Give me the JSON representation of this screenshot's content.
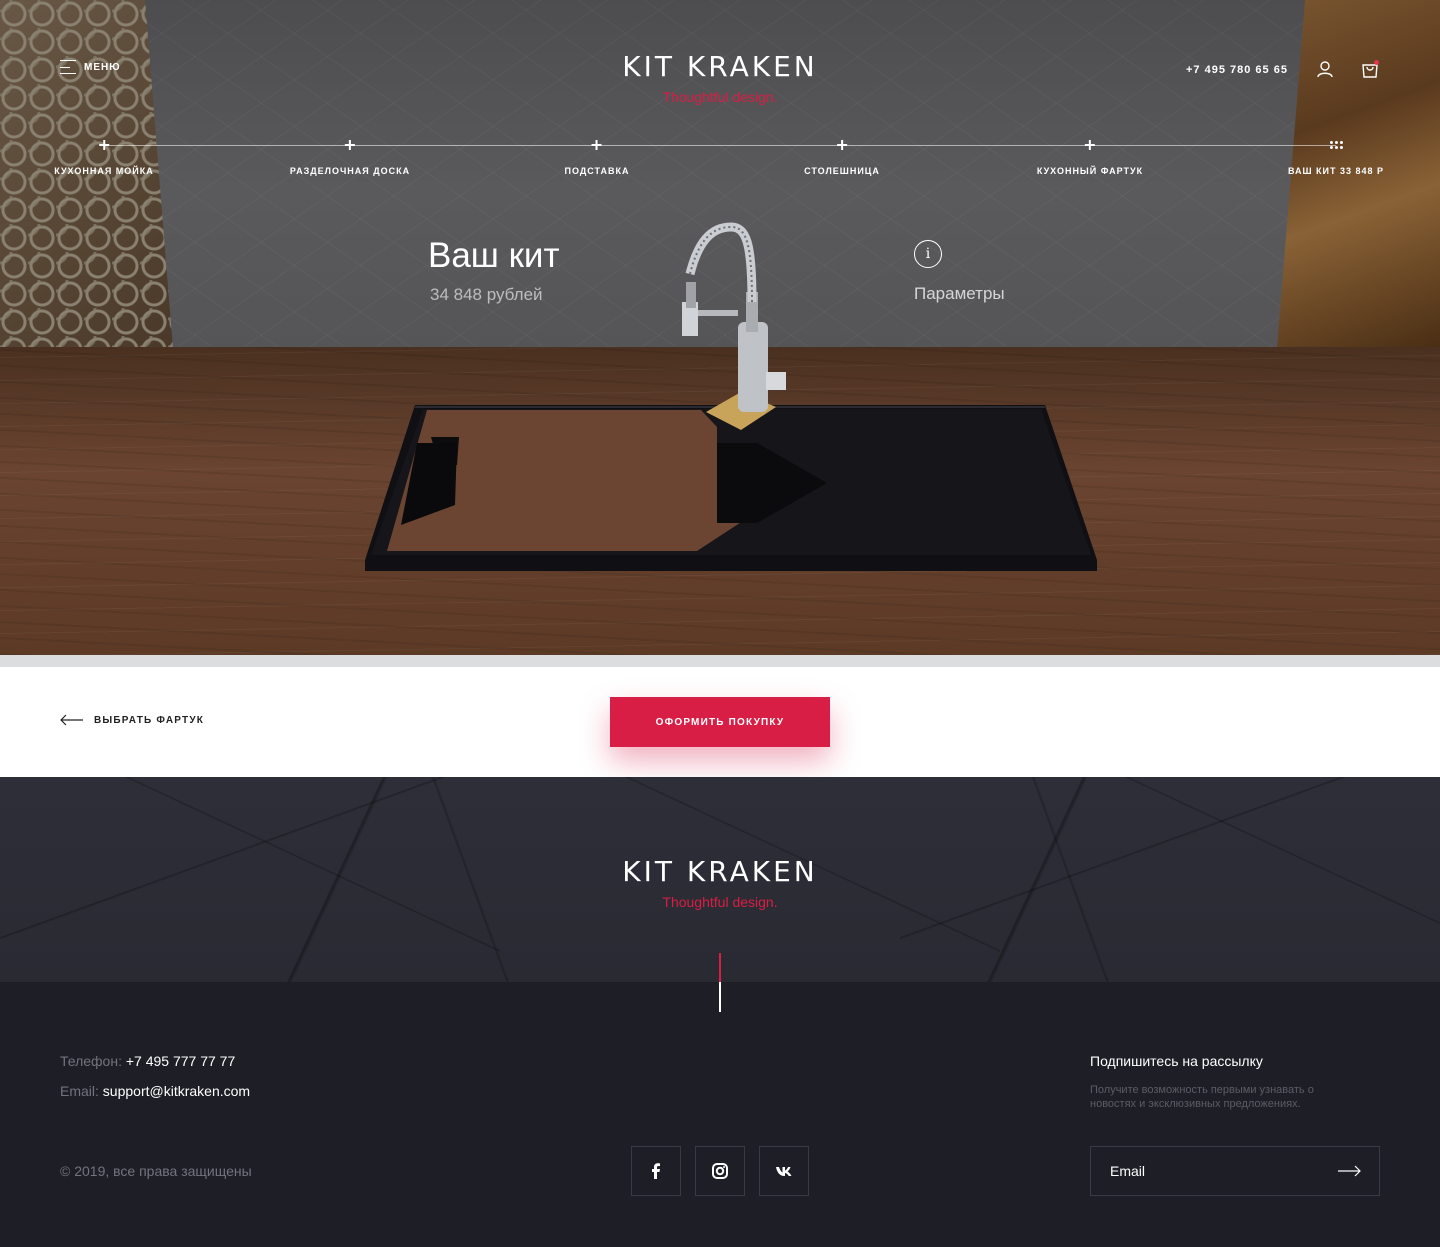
{
  "header": {
    "menu_label": "МЕНЮ",
    "logo_title": "KIT KRAKEN",
    "logo_tagline": "Thoughtful design.",
    "phone": "+7 495 780 65 65"
  },
  "steps": [
    {
      "label": "КУХОННАЯ МОЙКА",
      "icon": "plus-icon"
    },
    {
      "label": "РАЗДЕЛОЧНАЯ ДОСКА",
      "icon": "plus-icon"
    },
    {
      "label": "ПОДСТАВКА",
      "icon": "plus-icon"
    },
    {
      "label": "СТОЛЕШНИЦА",
      "icon": "plus-icon"
    },
    {
      "label": "КУХОННЫЙ ФАРТУК",
      "icon": "plus-icon"
    },
    {
      "label": "ВАШ КИТ 33 848 Р",
      "icon": "dots-grid-icon"
    }
  ],
  "kit": {
    "title": "Ваш кит",
    "price": "34 848 рублей",
    "params_label": "Параметры"
  },
  "actions": {
    "back_label": "ВЫБРАТЬ ФАРТУК",
    "buy_label": "ОФОРМИТЬ ПОКУПКУ"
  },
  "footer": {
    "logo_title": "KIT KRAKEN",
    "logo_tagline": "Thoughtful design.",
    "phone_key": "Телефон:",
    "phone_value": "+7 495 777 77 77",
    "email_key": "Email:",
    "email_value": "support@kitkraken.com",
    "copyright": "© 2019, все права защищены",
    "socials": [
      "facebook-icon",
      "instagram-icon",
      "vk-icon"
    ],
    "newsletter_title": "Подпишитесь на рассылку",
    "newsletter_text": "Получите возможность первыми узнавать о новостях и эксклюзивных предложениях.",
    "email_placeholder": "Email"
  },
  "colors": {
    "accent": "#d81e45",
    "footer_bg": "#1e1e26"
  }
}
